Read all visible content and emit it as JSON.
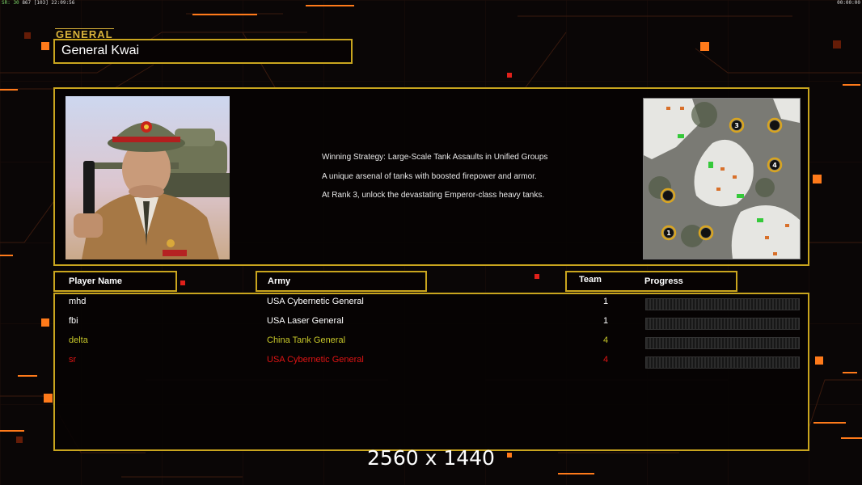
{
  "topbar": {
    "left_fps": "SR: 30",
    "left_values": "867 [103] 22:09:56",
    "right_clock": "00:00:00"
  },
  "general": {
    "section_label": "GENERAL",
    "name": "General Kwai",
    "strategy_lines": [
      "Winning Strategy: Large-Scale Tank Assaults in Unified Groups",
      "A unique arsenal of tanks with boosted firepower and armor.",
      "At Rank 3, unlock the devastating Emperor-class heavy tanks."
    ]
  },
  "minimap": {
    "start_positions": [
      "3",
      "4",
      "1"
    ]
  },
  "table": {
    "headers": {
      "player_name": "Player Name",
      "army": "Army",
      "team": "Team",
      "progress": "Progress"
    },
    "rows": [
      {
        "name": "mhd",
        "army": "USA Cybernetic General",
        "team": "1",
        "color": "#ffffff",
        "progress": 0
      },
      {
        "name": "fbi",
        "army": "USA Laser General",
        "team": "1",
        "color": "#ffffff",
        "progress": 0
      },
      {
        "name": "delta",
        "army": "China Tank General",
        "team": "4",
        "color": "#c8c82a",
        "progress": 0
      },
      {
        "name": "sr",
        "army": "USA Cybernetic General",
        "team": "4",
        "color": "#e01414",
        "progress": 0
      }
    ]
  },
  "footer": {
    "resolution": "2560 x 1440"
  },
  "colors": {
    "accent_gold": "#c9a51e",
    "orange_light": "#ff7a1a",
    "background": "#0a0606"
  }
}
